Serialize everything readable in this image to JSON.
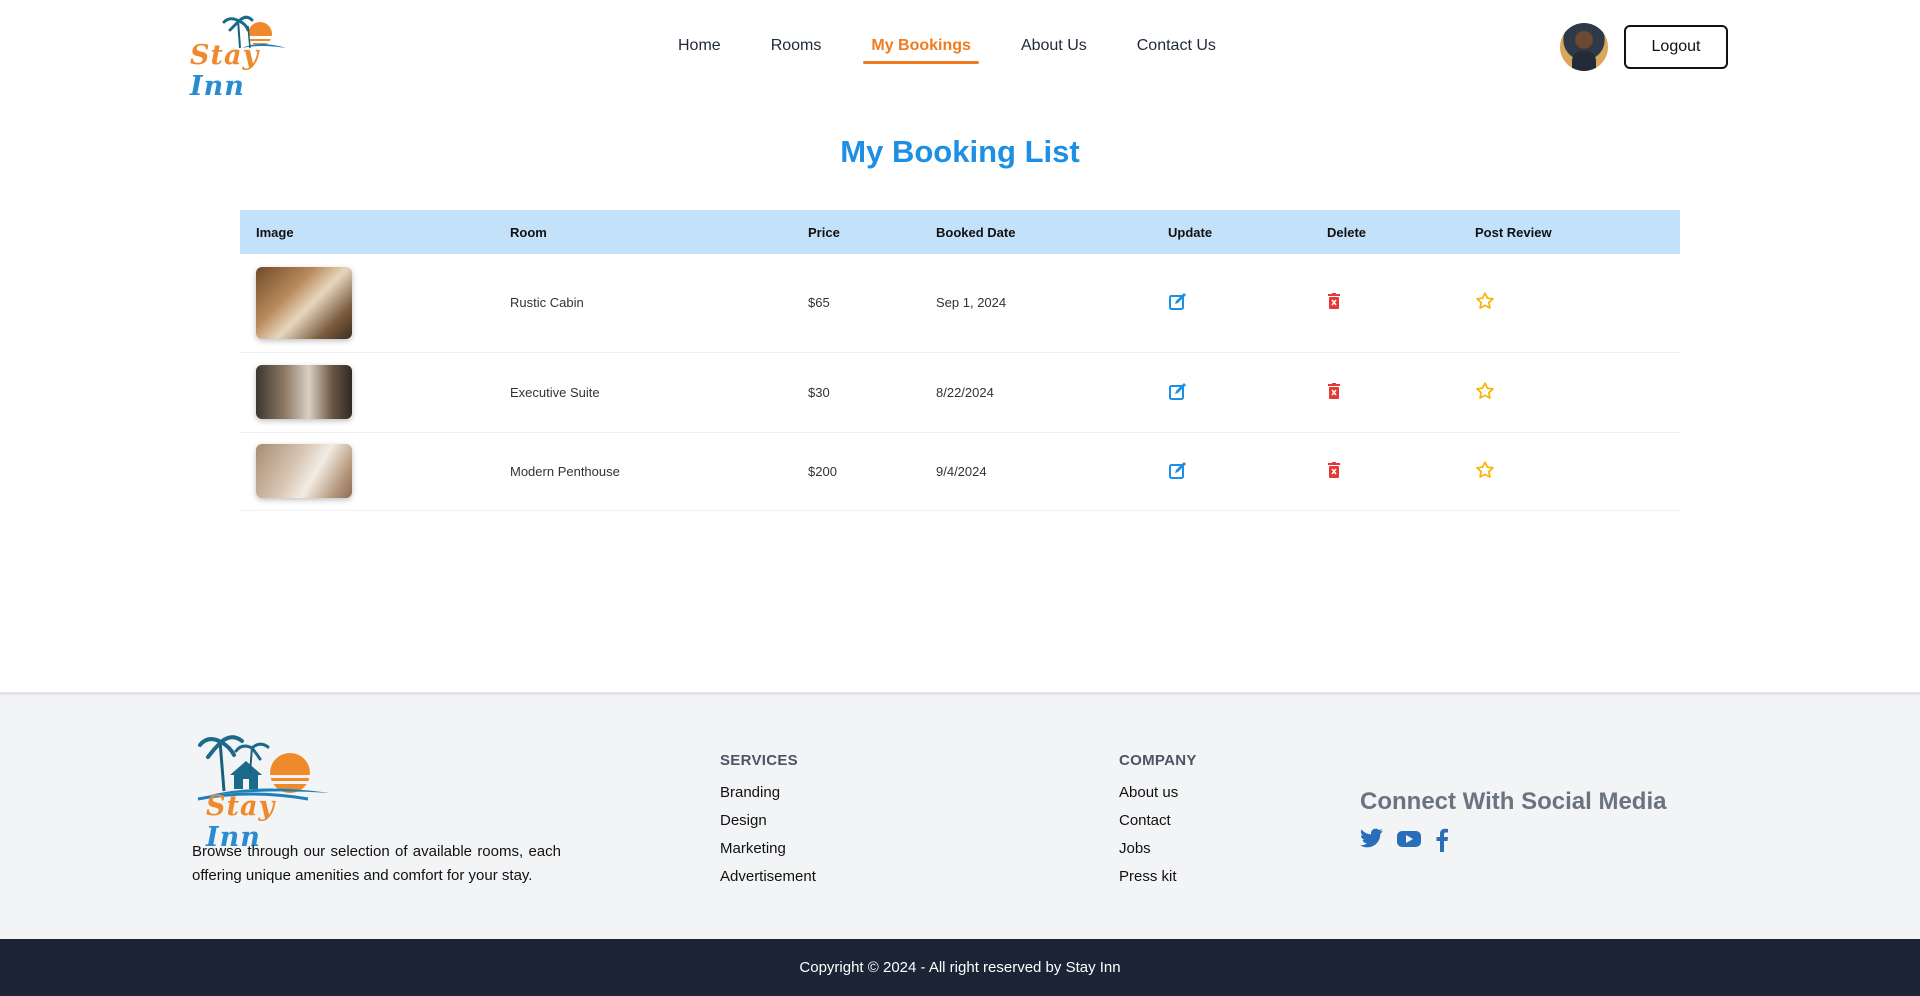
{
  "brand": {
    "name_part1": "Stay",
    "name_part2": "Inn"
  },
  "nav": {
    "items": [
      {
        "label": "Home"
      },
      {
        "label": "Rooms"
      },
      {
        "label": "My Bookings",
        "active": true
      },
      {
        "label": "About Us"
      },
      {
        "label": "Contact Us"
      }
    ]
  },
  "header": {
    "logout_label": "Logout"
  },
  "main": {
    "title": "My Booking List",
    "columns": [
      "Image",
      "Room",
      "Price",
      "Booked Date",
      "Update",
      "Delete",
      "Post Review"
    ],
    "rows": [
      {
        "room": "Rustic Cabin",
        "price": "$65",
        "date": "Sep 1, 2024"
      },
      {
        "room": "Executive Suite",
        "price": "$30",
        "date": "8/22/2024"
      },
      {
        "room": "Modern Penthouse",
        "price": "$200",
        "date": "9/4/2024"
      }
    ]
  },
  "footer": {
    "description": "Browse through our selection of available rooms, each offering unique amenities and comfort for your stay.",
    "services": {
      "heading": "SERVICES",
      "links": [
        "Branding",
        "Design",
        "Marketing",
        "Advertisement"
      ]
    },
    "company": {
      "heading": "COMPANY",
      "links": [
        "About us",
        "Contact",
        "Jobs",
        "Press kit"
      ]
    },
    "social": {
      "heading": "Connect With Social Media",
      "icons": [
        "twitter-icon",
        "youtube-icon",
        "facebook-icon"
      ]
    },
    "copyright": "Copyright © 2024 - All right reserved by Stay Inn"
  },
  "colors": {
    "accent_orange": "#f07b1e",
    "title_blue": "#1d8fe4",
    "table_header": "#c4e1fa",
    "edit_icon": "#1d8fe4",
    "delete_icon": "#e53935",
    "star_icon": "#f5b400",
    "footer_bg": "#f3f4f6",
    "copyright_bg": "#1c2536",
    "social_icon": "#2a6ebb"
  }
}
